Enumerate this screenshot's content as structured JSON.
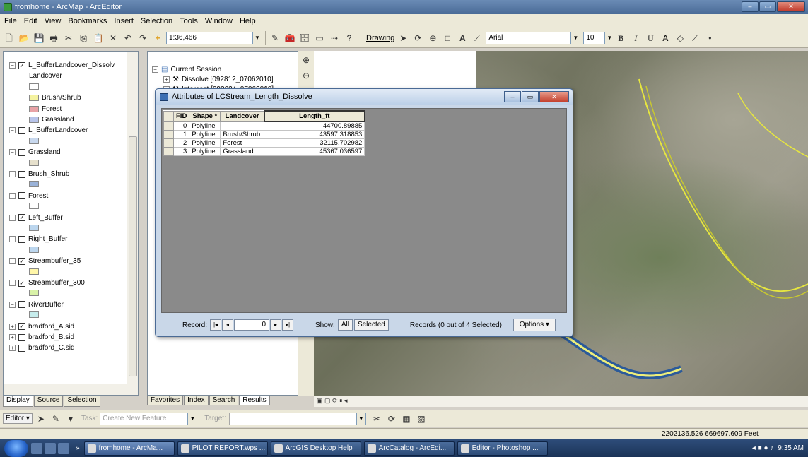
{
  "window": {
    "title": "fromhome - ArcMap - ArcEditor",
    "controls": [
      "–",
      "▭",
      "✕"
    ]
  },
  "menu": [
    "File",
    "Edit",
    "View",
    "Bookmarks",
    "Insert",
    "Selection",
    "Tools",
    "Window",
    "Help"
  ],
  "toolbar": {
    "scale": "1:36,466",
    "drawing_label": "Drawing",
    "font": "Arial",
    "font_size": "10",
    "bold": "B",
    "italic": "I",
    "underline": "U",
    "text_color": "A"
  },
  "toc": {
    "rows": [
      {
        "type": "layer",
        "expand": "⊟",
        "checked": true,
        "label": "L_BufferLandcover_Dissolv",
        "indent": 0
      },
      {
        "type": "text",
        "label": "Landcover",
        "indent": 2
      },
      {
        "type": "legend",
        "label": "",
        "color": "#ffffff",
        "indent": 2
      },
      {
        "type": "legend",
        "label": "Brush/Shrub",
        "color": "#f5f3a0",
        "indent": 2
      },
      {
        "type": "legend",
        "label": "Forest",
        "color": "#e8a2a6",
        "indent": 2
      },
      {
        "type": "legend",
        "label": "Grassland",
        "color": "#b8c4ea",
        "indent": 2
      },
      {
        "type": "layer",
        "expand": "⊟",
        "checked": false,
        "label": "L_BufferLandcover",
        "indent": 0
      },
      {
        "type": "legend",
        "label": "",
        "color": "#c8d8ee",
        "indent": 2
      },
      {
        "type": "layer",
        "expand": "⊟",
        "checked": false,
        "label": "Grassland",
        "indent": 0
      },
      {
        "type": "legend",
        "label": "",
        "color": "#e6e0cc",
        "indent": 2
      },
      {
        "type": "layer",
        "expand": "⊟",
        "checked": false,
        "label": "Brush_Shrub",
        "indent": 0
      },
      {
        "type": "legend",
        "label": "",
        "color": "#9ab2d8",
        "indent": 2
      },
      {
        "type": "layer",
        "expand": "⊟",
        "checked": false,
        "label": "Forest",
        "indent": 0
      },
      {
        "type": "legend",
        "label": "",
        "color": "#ffffff",
        "indent": 2
      },
      {
        "type": "layer",
        "expand": "⊟",
        "checked": true,
        "label": "Left_Buffer",
        "indent": 0
      },
      {
        "type": "legend",
        "label": "",
        "color": "#bcd6ee",
        "indent": 2
      },
      {
        "type": "layer",
        "expand": "⊟",
        "checked": false,
        "label": "Right_Buffer",
        "indent": 0
      },
      {
        "type": "legend",
        "label": "",
        "color": "#bcd6ee",
        "indent": 2
      },
      {
        "type": "layer",
        "expand": "⊟",
        "checked": true,
        "label": "Streambuffer_35",
        "indent": 0
      },
      {
        "type": "legend",
        "label": "",
        "color": "#fff6a8",
        "indent": 2
      },
      {
        "type": "layer",
        "expand": "⊟",
        "checked": true,
        "label": "Streambuffer_300",
        "indent": 0
      },
      {
        "type": "legend",
        "label": "",
        "color": "#d9f2a8",
        "indent": 2
      },
      {
        "type": "layer",
        "expand": "⊟",
        "checked": false,
        "label": "RiverBuffer",
        "indent": 0
      },
      {
        "type": "legend",
        "label": "",
        "color": "#c6ecec",
        "indent": 2
      },
      {
        "type": "layer",
        "expand": "⊞",
        "checked": true,
        "label": "bradford_A.sid",
        "indent": 0
      },
      {
        "type": "layer",
        "expand": "⊞",
        "checked": false,
        "label": "bradford_B.sid",
        "indent": 0
      },
      {
        "type": "layer",
        "expand": "⊞",
        "checked": false,
        "label": "bradford_C.sid",
        "indent": 0
      }
    ],
    "tabs": [
      "Display",
      "Source",
      "Selection"
    ]
  },
  "results_panel": {
    "root": "Current Session",
    "items": [
      "Dissolve [092812_07062010]",
      "Intersect [092624_07062010]"
    ],
    "tabs": [
      "Favorites",
      "Index",
      "Search",
      "Results"
    ]
  },
  "attribute_table": {
    "title": "Attributes of LCStream_Length_Dissolve",
    "columns": [
      "FID",
      "Shape *",
      "Landcover",
      "Length_ft"
    ],
    "rows": [
      [
        "0",
        "Polyline",
        "",
        "44700.89885"
      ],
      [
        "1",
        "Polyline",
        "Brush/Shrub",
        "43597.318853"
      ],
      [
        "2",
        "Polyline",
        "Forest",
        "32115.702982"
      ],
      [
        "3",
        "Polyline",
        "Grassland",
        "45367.036597"
      ]
    ],
    "footer": {
      "record_label": "Record:",
      "record_value": "0",
      "show_label": "Show:",
      "show_all": "All",
      "show_selected": "Selected",
      "records_status": "Records (0 out of 4 Selected)",
      "options": "Options"
    }
  },
  "editor_bar": {
    "editor_label": "Editor",
    "task_label": "Task:",
    "task_value": "Create New Feature",
    "target_label": "Target:"
  },
  "status_bar": {
    "coordinates": "2202136.526 669697.609 Feet"
  },
  "taskbar": {
    "tasks": [
      "fromhome - ArcMa...",
      "PILOT REPORT.wps ...",
      "ArcGIS Desktop Help",
      "ArcCatalog - ArcEdi...",
      "Editor - Photoshop ..."
    ],
    "clock": "9:35 AM"
  }
}
